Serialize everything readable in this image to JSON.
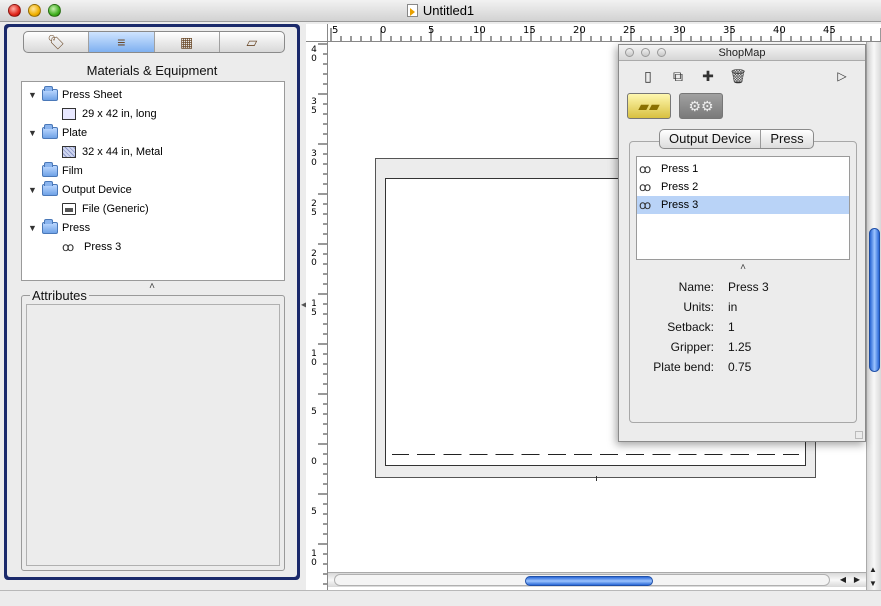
{
  "window": {
    "title": "Untitled1"
  },
  "drawer": {
    "tabs": [
      {
        "name": "info-tab",
        "glyph": "🏷",
        "active": false
      },
      {
        "name": "materials-tab",
        "glyph": "≡",
        "active": true
      },
      {
        "name": "layout-tab",
        "glyph": "▦",
        "active": false
      },
      {
        "name": "stack-tab",
        "glyph": "▱",
        "active": false
      }
    ],
    "materials_title": "Materials & Equipment",
    "tree": [
      {
        "label": "Press Sheet",
        "type": "folder"
      },
      {
        "label": "29 x 42 in, long",
        "type": "sheet"
      },
      {
        "label": "Plate",
        "type": "folder"
      },
      {
        "label": "32 x 44 in, Metal",
        "type": "plate"
      },
      {
        "label": "Film",
        "type": "folder-leaf"
      },
      {
        "label": "Output Device",
        "type": "folder"
      },
      {
        "label": "File (Generic)",
        "type": "file"
      },
      {
        "label": "Press",
        "type": "folder"
      },
      {
        "label": "Press 3",
        "type": "press"
      }
    ],
    "collapse_caret": "˄",
    "attributes_title": "Attributes"
  },
  "ruler": {
    "top_labels": [
      "5",
      "0",
      "5",
      "10",
      "15",
      "20",
      "25",
      "30",
      "35",
      "40",
      "45"
    ],
    "left_labels": [
      "40",
      "35",
      "30",
      "25",
      "20",
      "15",
      "10",
      "5",
      "0",
      "5",
      "10"
    ]
  },
  "palette": {
    "title": "ShopMap",
    "toolbar": {
      "new": "▯",
      "duplicate": "⧉",
      "add": "✚",
      "delete": "🗑",
      "play": "▷"
    },
    "segments": [
      "Output Device",
      "Press"
    ],
    "list": [
      {
        "label": "Press 1",
        "selected": false
      },
      {
        "label": "Press 2",
        "selected": false
      },
      {
        "label": "Press 3",
        "selected": true
      }
    ],
    "caret": "˄",
    "properties": [
      {
        "label": "Name:",
        "value": "Press 3"
      },
      {
        "label": "Units:",
        "value": "in"
      },
      {
        "label": "Setback:",
        "value": "1"
      },
      {
        "label": "Gripper:",
        "value": "1.25"
      },
      {
        "label": "Plate bend:",
        "value": "0.75"
      }
    ]
  },
  "colors": {
    "accent": "#2a68d8",
    "selection": "#b9d3f7",
    "drawer_frame": "#1b2a6b"
  }
}
